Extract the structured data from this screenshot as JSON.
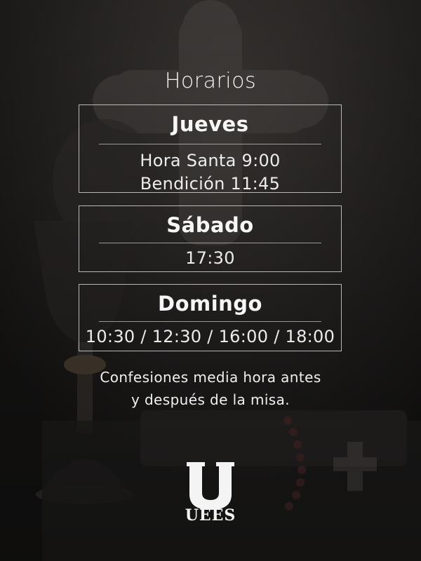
{
  "title": "Horarios",
  "schedule": [
    {
      "day": "Jueves",
      "lines": [
        "Hora Santa 9:00",
        "Bendición 11:45"
      ]
    },
    {
      "day": "Sábado",
      "lines": [
        "17:30"
      ]
    },
    {
      "day": "Domingo",
      "lines": [
        "10:30 / 12:30 / 16:00 / 18:00"
      ]
    }
  ],
  "note": {
    "line1": "Confesiones media hora antes",
    "line2": "y después de la misa."
  },
  "logo": {
    "wordmark": "UEES",
    "icon": "uees-u-logo-icon"
  },
  "background": {
    "icon": "chalice-cross-rosary-photo"
  },
  "colors": {
    "background": "#1c1a19",
    "text": "#f2f2f2",
    "border": "#ebebeb"
  }
}
